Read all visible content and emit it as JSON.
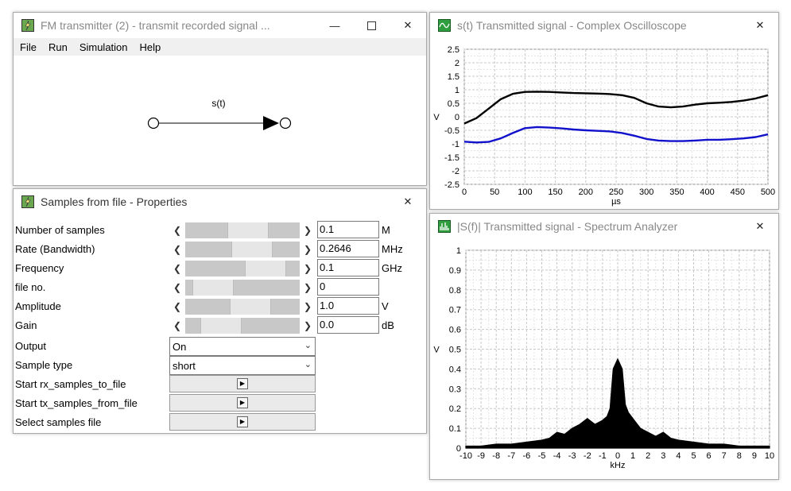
{
  "fm_window": {
    "title": "FM transmitter (2) - transmit recorded signal ...",
    "menu": [
      "File",
      "Run",
      "Simulation",
      "Help"
    ],
    "signal_label": "s(t)"
  },
  "props_window": {
    "title": "Samples from file - Properties",
    "params": [
      {
        "label": "Number of samples",
        "value": "0.1",
        "unit": "M",
        "thumb": 0.56
      },
      {
        "label": "Rate (Bandwidth)",
        "value": "0.2646",
        "unit": "MHz",
        "thumb": 0.62
      },
      {
        "label": "Frequency",
        "value": "0.1",
        "unit": "GHz",
        "thumb": 0.8
      },
      {
        "label": "file no.",
        "value": "0",
        "unit": "",
        "thumb": 0.1
      },
      {
        "label": "Amplitude",
        "value": "1.0",
        "unit": "V",
        "thumb": 0.6
      },
      {
        "label": "Gain",
        "value": "0.0",
        "unit": "dB",
        "thumb": 0.2
      }
    ],
    "output_label": "Output",
    "output_value": "On",
    "sample_type_label": "Sample type",
    "sample_type_value": "short",
    "actions": [
      "Start rx_samples_to_file",
      "Start tx_samples_from_file",
      "Select samples file"
    ]
  },
  "osc_window": {
    "title": "s(t) Transmitted signal - Complex Oscilloscope",
    "chart_data": {
      "type": "line",
      "xlabel": "µs",
      "ylabel": "V",
      "xlim": [
        0,
        500
      ],
      "ylim": [
        -2.5,
        2.5
      ],
      "xticks": [
        0,
        50,
        100,
        150,
        200,
        250,
        300,
        350,
        400,
        450,
        500
      ],
      "yticks": [
        -2.5,
        -2,
        -1.5,
        -1,
        -0.5,
        0,
        0.5,
        1,
        1.5,
        2,
        2.5
      ],
      "grid": true,
      "series": [
        {
          "color": "#000000",
          "x": [
            0,
            20,
            40,
            60,
            80,
            100,
            120,
            140,
            160,
            180,
            200,
            220,
            240,
            260,
            280,
            300,
            320,
            340,
            360,
            380,
            400,
            420,
            440,
            460,
            480,
            500
          ],
          "y": [
            -0.25,
            -0.05,
            0.3,
            0.65,
            0.85,
            0.92,
            0.93,
            0.92,
            0.9,
            0.88,
            0.87,
            0.86,
            0.84,
            0.8,
            0.7,
            0.5,
            0.38,
            0.35,
            0.38,
            0.45,
            0.5,
            0.52,
            0.55,
            0.6,
            0.68,
            0.8
          ]
        },
        {
          "color": "#1111cc",
          "x": [
            0,
            20,
            40,
            60,
            80,
            100,
            120,
            140,
            160,
            180,
            200,
            220,
            240,
            260,
            280,
            300,
            320,
            340,
            360,
            380,
            400,
            420,
            440,
            460,
            480,
            500
          ],
          "y": [
            -0.92,
            -0.95,
            -0.93,
            -0.8,
            -0.6,
            -0.42,
            -0.38,
            -0.4,
            -0.43,
            -0.47,
            -0.5,
            -0.52,
            -0.54,
            -0.6,
            -0.7,
            -0.82,
            -0.88,
            -0.9,
            -0.9,
            -0.88,
            -0.85,
            -0.85,
            -0.83,
            -0.8,
            -0.75,
            -0.65
          ]
        }
      ]
    }
  },
  "spec_window": {
    "title": "|S(f)| Transmitted signal - Spectrum Analyzer",
    "chart_data": {
      "type": "area",
      "xlabel": "kHz",
      "ylabel": "V",
      "xlim": [
        -10,
        10
      ],
      "ylim": [
        0,
        1
      ],
      "xticks": [
        -10,
        -9,
        -8,
        -7,
        -6,
        -5,
        -4,
        -3,
        -2,
        -1,
        0,
        1,
        2,
        3,
        4,
        5,
        6,
        7,
        8,
        9,
        10
      ],
      "yticks": [
        0,
        0.1,
        0.2,
        0.3,
        0.4,
        0.5,
        0.6,
        0.7,
        0.8,
        0.9,
        1
      ],
      "grid": true,
      "series": [
        {
          "color": "#000000",
          "x": [
            -10,
            -9,
            -8,
            -7,
            -6,
            -5,
            -4.5,
            -4,
            -3.5,
            -3,
            -2.5,
            -2,
            -1.5,
            -1,
            -0.7,
            -0.5,
            -0.3,
            0,
            0.3,
            0.5,
            0.7,
            1,
            1.5,
            2,
            2.5,
            3,
            3.5,
            4,
            5,
            6,
            7,
            8,
            9,
            10
          ],
          "y": [
            0.01,
            0.01,
            0.02,
            0.02,
            0.03,
            0.04,
            0.05,
            0.08,
            0.07,
            0.1,
            0.12,
            0.15,
            0.12,
            0.14,
            0.16,
            0.2,
            0.4,
            0.45,
            0.4,
            0.22,
            0.18,
            0.15,
            0.1,
            0.08,
            0.06,
            0.08,
            0.05,
            0.04,
            0.03,
            0.02,
            0.02,
            0.01,
            0.01,
            0.01
          ]
        }
      ]
    }
  }
}
